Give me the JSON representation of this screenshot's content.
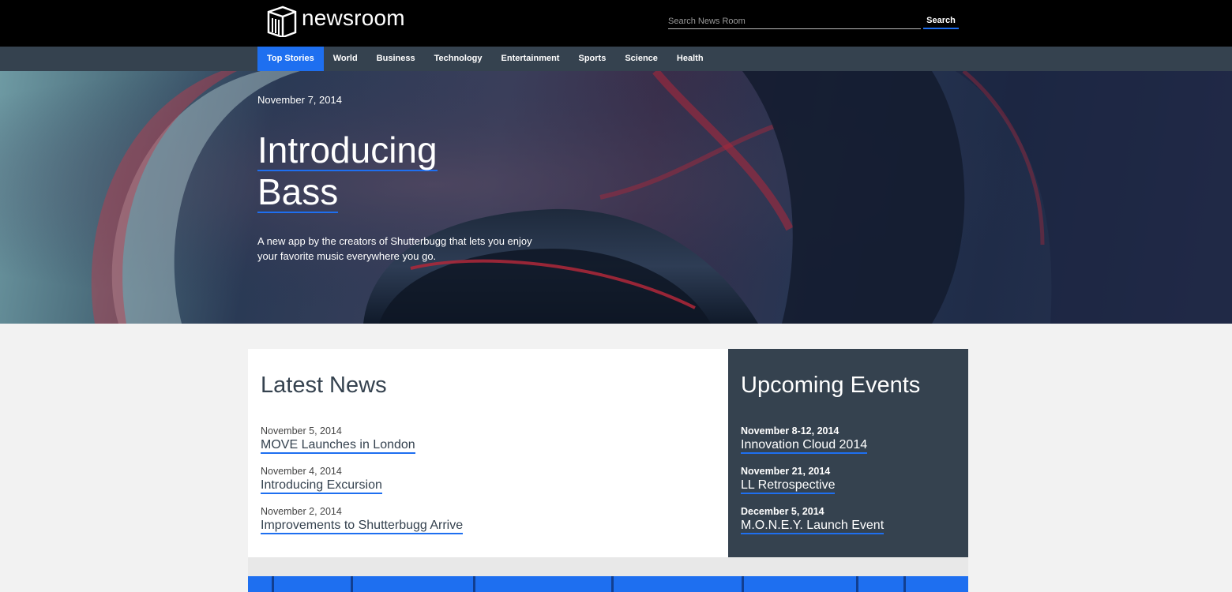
{
  "header": {
    "logo_text": "newsroom",
    "search_placeholder": "Search News Room",
    "search_button": "Search"
  },
  "nav": {
    "items": [
      "Top Stories",
      "World",
      "Business",
      "Technology",
      "Entertainment",
      "Sports",
      "Science",
      "Health"
    ],
    "active": "Top Stories"
  },
  "hero": {
    "date": "November 7, 2014",
    "title_line1": "Introducing",
    "title_line2": "Bass",
    "description": "A new app by the creators of Shutterbugg that lets you enjoy your favorite music everywhere you go."
  },
  "latest_news": {
    "heading": "Latest News",
    "items": [
      {
        "date": "November 5, 2014",
        "title": "MOVE Launches in London"
      },
      {
        "date": "November 4, 2014",
        "title": "Introducing Excursion"
      },
      {
        "date": "November 2, 2014",
        "title": "Improvements to Shutterbugg Arrive"
      }
    ]
  },
  "upcoming_events": {
    "heading": "Upcoming Events",
    "items": [
      {
        "date": "November 8-12, 2014",
        "title": "Innovation Cloud 2014"
      },
      {
        "date": "November 21, 2014",
        "title": "LL Retrospective"
      },
      {
        "date": "December 5, 2014",
        "title": "M.O.N.E.Y. Launch Event"
      }
    ]
  },
  "colors": {
    "accent": "#1e6ff0",
    "topbar": "#000000",
    "navbar": "#35424f",
    "page_background": "#f2f2f2"
  },
  "icons": {
    "logo": "building-logo-icon"
  }
}
